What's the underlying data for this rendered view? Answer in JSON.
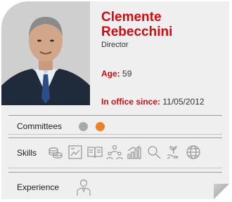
{
  "profile": {
    "first_name": "Clemente",
    "last_name": "Rebecchini",
    "role": "Director",
    "age_label": "Age:",
    "age_value": "59",
    "office_label": "In office since:",
    "office_value": "11/05/2012"
  },
  "sections": {
    "committees_label": "Committees",
    "skills_label": "Skills",
    "experience_label": "Experience"
  },
  "committees": [
    {
      "color": "#a9a9a9"
    },
    {
      "color": "#e8832a"
    }
  ],
  "skills": [
    {
      "icon": "coins-stack-icon"
    },
    {
      "icon": "chart-document-icon"
    },
    {
      "icon": "open-book-icon"
    },
    {
      "icon": "team-people-icon"
    },
    {
      "icon": "growth-bars-icon"
    },
    {
      "icon": "magnifier-icon"
    },
    {
      "icon": "plant-hand-icon"
    },
    {
      "icon": "globe-icon"
    }
  ],
  "experience": [
    {
      "icon": "person-icon"
    }
  ],
  "colors": {
    "accent": "#d10a11",
    "card_bg": "#efefef"
  }
}
